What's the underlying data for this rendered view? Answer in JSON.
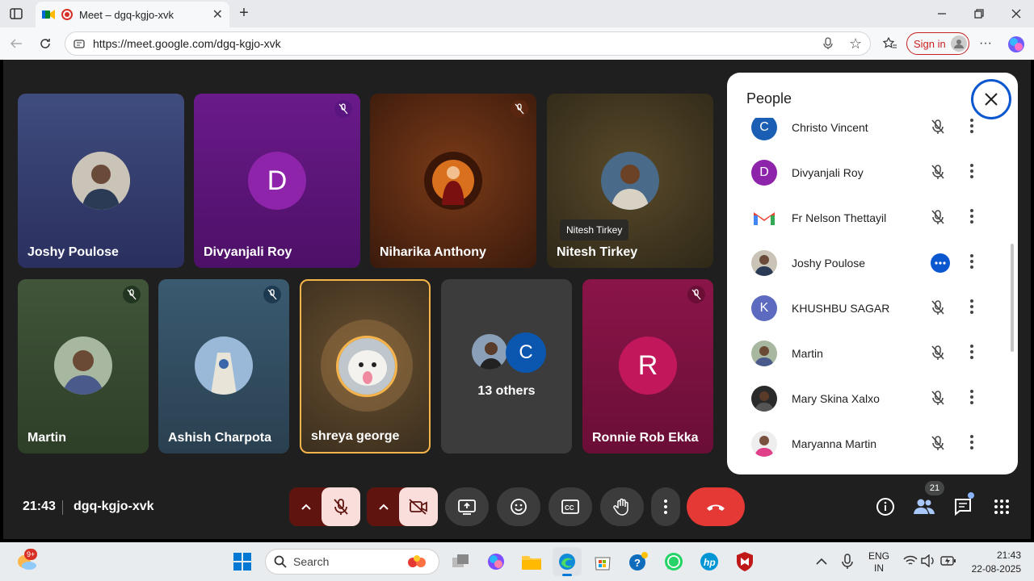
{
  "browser": {
    "tab_title": "Meet – dgq-kgjo-xvk",
    "url": "https://meet.google.com/dgq-kgjo-xvk",
    "sign_in": "Sign in"
  },
  "tiles": [
    {
      "name": "Joshy Poulose"
    },
    {
      "name": "Divyanjali Roy",
      "initial": "D"
    },
    {
      "name": "Niharika Anthony"
    },
    {
      "name": "Nitesh Tirkey",
      "tooltip": "Nitesh Tirkey"
    },
    {
      "name": "Martin"
    },
    {
      "name": "Ashish Charpota"
    },
    {
      "name": "shreya george"
    },
    {
      "name": "13 others",
      "initial": "C"
    },
    {
      "name": "Ronnie Rob Ekka",
      "initial": "R"
    }
  ],
  "people_panel": {
    "title": "People",
    "members": [
      {
        "name": "Christo Vincent",
        "initial": "C",
        "color": "#1a5fb4"
      },
      {
        "name": "Divyanjali Roy",
        "initial": "D",
        "color": "#8e24aa"
      },
      {
        "name": "Fr Nelson Thettayil",
        "initial": "M",
        "color": "#ffffff"
      },
      {
        "name": "Joshy Poulose",
        "initial": "",
        "color": "#6b6b6b"
      },
      {
        "name": "KHUSHBU SAGAR",
        "initial": "K",
        "color": "#5c6bc0"
      },
      {
        "name": "Martin",
        "initial": "",
        "color": "#7a5a40"
      },
      {
        "name": "Mary Skina Xalxo",
        "initial": "",
        "color": "#333333"
      },
      {
        "name": "Maryanna Martin",
        "initial": "",
        "color": "#d0a0b0"
      }
    ]
  },
  "bottom": {
    "time": "21:43",
    "meeting_code": "dgq-kgjo-xvk",
    "participant_count": "21"
  },
  "taskbar": {
    "notif_badge": "9+",
    "search_placeholder": "Search",
    "lang_top": "ENG",
    "lang_bottom": "IN",
    "clock_time": "21:43",
    "clock_date": "22-08-2025"
  },
  "colors": {
    "end_call": "#e53935",
    "accent": "#0b57d0",
    "dark_red_ctrl": "#601410",
    "pink_ctrl": "#f9dedc"
  }
}
